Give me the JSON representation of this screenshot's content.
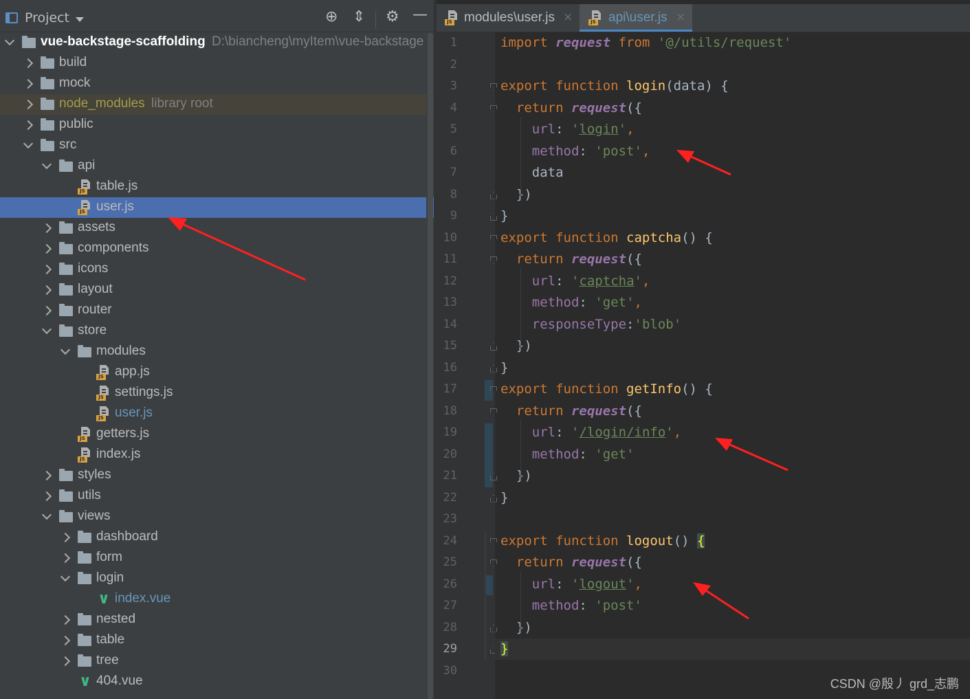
{
  "project_panel": {
    "title": "Project",
    "tools": [
      "locate-icon",
      "collapse-icon",
      "gear-icon",
      "hide-icon"
    ]
  },
  "tree": [
    {
      "label": "vue-backstage-scaffolding",
      "hint": "D:\\biancheng\\myItem\\vue-backstage",
      "kind": "folder",
      "expanded": true,
      "bold": true
    },
    {
      "label": "build",
      "kind": "folder"
    },
    {
      "label": "mock",
      "kind": "folder"
    },
    {
      "label": "node_modules",
      "hint": "library root",
      "kind": "folder",
      "excluded": true
    },
    {
      "label": "public",
      "kind": "folder"
    },
    {
      "label": "src",
      "kind": "folder",
      "expanded": true
    },
    {
      "label": "api",
      "kind": "folder",
      "expanded": true
    },
    {
      "label": "table.js",
      "kind": "js"
    },
    {
      "label": "user.js",
      "kind": "js",
      "selected": true
    },
    {
      "label": "assets",
      "kind": "folder"
    },
    {
      "label": "components",
      "kind": "folder"
    },
    {
      "label": "icons",
      "kind": "folder"
    },
    {
      "label": "layout",
      "kind": "folder"
    },
    {
      "label": "router",
      "kind": "folder"
    },
    {
      "label": "store",
      "kind": "folder",
      "expanded": true
    },
    {
      "label": "modules",
      "kind": "folder",
      "expanded": true
    },
    {
      "label": "app.js",
      "kind": "js"
    },
    {
      "label": "settings.js",
      "kind": "js"
    },
    {
      "label": "user.js",
      "kind": "js",
      "modified": true
    },
    {
      "label": "getters.js",
      "kind": "js"
    },
    {
      "label": "index.js",
      "kind": "js"
    },
    {
      "label": "styles",
      "kind": "folder"
    },
    {
      "label": "utils",
      "kind": "folder"
    },
    {
      "label": "views",
      "kind": "folder",
      "expanded": true
    },
    {
      "label": "dashboard",
      "kind": "folder"
    },
    {
      "label": "form",
      "kind": "folder"
    },
    {
      "label": "login",
      "kind": "folder",
      "expanded": true
    },
    {
      "label": "index.vue",
      "kind": "vue",
      "modified": true
    },
    {
      "label": "nested",
      "kind": "folder"
    },
    {
      "label": "table",
      "kind": "folder"
    },
    {
      "label": "tree",
      "kind": "folder"
    },
    {
      "label": "404.vue",
      "kind": "vue"
    }
  ],
  "tabs": [
    {
      "label": "modules\\user.js",
      "close": "×",
      "active": false
    },
    {
      "label": "api\\user.js",
      "close": "×",
      "active": true
    }
  ],
  "editor": {
    "current_line": "29",
    "lines": [
      {
        "no": "1",
        "tokens": [
          [
            "kw",
            "import "
          ],
          [
            "call",
            "request"
          ],
          [
            "kw",
            " from "
          ],
          [
            "str",
            "'@/utils/request'"
          ]
        ]
      },
      {
        "no": "2",
        "tokens": []
      },
      {
        "no": "3",
        "tokens": [
          [
            "kw",
            "export function "
          ],
          [
            "fn",
            "login"
          ],
          [
            "",
            "(data) {"
          ]
        ]
      },
      {
        "no": "4",
        "tokens": [
          [
            "",
            "  "
          ],
          [
            "kw",
            "return "
          ],
          [
            "call",
            "request"
          ],
          [
            "",
            "({"
          ]
        ]
      },
      {
        "no": "5",
        "tokens": [
          [
            "",
            "    "
          ],
          [
            "prop",
            "url"
          ],
          [
            "",
            ": "
          ],
          [
            "str",
            "'"
          ],
          [
            "str-ul",
            "login"
          ],
          [
            "str",
            "'"
          ],
          [
            "kw",
            ","
          ]
        ]
      },
      {
        "no": "6",
        "tokens": [
          [
            "",
            "    "
          ],
          [
            "prop",
            "method"
          ],
          [
            "",
            ": "
          ],
          [
            "str",
            "'post'"
          ],
          [
            "kw",
            ","
          ]
        ]
      },
      {
        "no": "7",
        "tokens": [
          [
            "",
            "    data"
          ]
        ]
      },
      {
        "no": "8",
        "tokens": [
          [
            "",
            "  })"
          ]
        ]
      },
      {
        "no": "9",
        "tokens": [
          [
            "",
            "}"
          ]
        ]
      },
      {
        "no": "10",
        "tokens": [
          [
            "kw",
            "export function "
          ],
          [
            "fn",
            "captcha"
          ],
          [
            "",
            "() {"
          ]
        ]
      },
      {
        "no": "11",
        "tokens": [
          [
            "",
            "  "
          ],
          [
            "kw",
            "return "
          ],
          [
            "call",
            "request"
          ],
          [
            "",
            "({"
          ]
        ]
      },
      {
        "no": "12",
        "tokens": [
          [
            "",
            "    "
          ],
          [
            "prop",
            "url"
          ],
          [
            "",
            ": "
          ],
          [
            "str",
            "'"
          ],
          [
            "str-ul",
            "captcha"
          ],
          [
            "str",
            "'"
          ],
          [
            "kw",
            ","
          ]
        ]
      },
      {
        "no": "13",
        "tokens": [
          [
            "",
            "    "
          ],
          [
            "prop",
            "method"
          ],
          [
            "",
            ": "
          ],
          [
            "str",
            "'get'"
          ],
          [
            "kw",
            ","
          ]
        ]
      },
      {
        "no": "14",
        "tokens": [
          [
            "",
            "    "
          ],
          [
            "prop",
            "responseType"
          ],
          [
            "",
            ":"
          ],
          [
            "str",
            "'blob'"
          ]
        ]
      },
      {
        "no": "15",
        "tokens": [
          [
            "",
            "  })"
          ]
        ]
      },
      {
        "no": "16",
        "tokens": [
          [
            "",
            "}"
          ]
        ]
      },
      {
        "no": "17",
        "tokens": [
          [
            "kw",
            "export function "
          ],
          [
            "fn",
            "getInfo"
          ],
          [
            "",
            "() {"
          ]
        ]
      },
      {
        "no": "18",
        "tokens": [
          [
            "",
            "  "
          ],
          [
            "kw",
            "return "
          ],
          [
            "call",
            "request"
          ],
          [
            "",
            "({"
          ]
        ]
      },
      {
        "no": "19",
        "tokens": [
          [
            "",
            "    "
          ],
          [
            "prop",
            "url"
          ],
          [
            "",
            ": "
          ],
          [
            "str",
            "'"
          ],
          [
            "str-ul",
            "/login/info"
          ],
          [
            "str",
            "'"
          ],
          [
            "kw",
            ","
          ]
        ]
      },
      {
        "no": "20",
        "tokens": [
          [
            "",
            "    "
          ],
          [
            "prop",
            "method"
          ],
          [
            "",
            ": "
          ],
          [
            "str",
            "'get'"
          ]
        ]
      },
      {
        "no": "21",
        "tokens": [
          [
            "",
            "  })"
          ]
        ]
      },
      {
        "no": "22",
        "tokens": [
          [
            "",
            "}"
          ]
        ]
      },
      {
        "no": "23",
        "tokens": []
      },
      {
        "no": "24",
        "tokens": [
          [
            "kw",
            "export function "
          ],
          [
            "fn",
            "logout"
          ],
          [
            "",
            "() "
          ],
          [
            "brace-hl",
            "{"
          ]
        ]
      },
      {
        "no": "25",
        "tokens": [
          [
            "",
            "  "
          ],
          [
            "kw",
            "return "
          ],
          [
            "call",
            "request"
          ],
          [
            "",
            "({"
          ]
        ]
      },
      {
        "no": "26",
        "tokens": [
          [
            "",
            "    "
          ],
          [
            "prop",
            "url"
          ],
          [
            "",
            ": "
          ],
          [
            "str",
            "'"
          ],
          [
            "str-ul",
            "logout"
          ],
          [
            "str",
            "'"
          ],
          [
            "kw",
            ","
          ]
        ]
      },
      {
        "no": "27",
        "tokens": [
          [
            "",
            "    "
          ],
          [
            "prop",
            "method"
          ],
          [
            "",
            ": "
          ],
          [
            "str",
            "'post'"
          ]
        ]
      },
      {
        "no": "28",
        "tokens": [
          [
            "",
            "  })"
          ]
        ]
      },
      {
        "no": "29",
        "tokens": [
          [
            "brace-hl",
            "}"
          ]
        ]
      },
      {
        "no": "30",
        "tokens": []
      }
    ]
  },
  "watermark": "CSDN @殷丿 grd_志鹏",
  "colors": {
    "keyword": "#cc7832",
    "function": "#ffc66d",
    "string": "#6a8759",
    "selection": "#4b6eaf",
    "annotation_arrow": "#ff2020"
  }
}
